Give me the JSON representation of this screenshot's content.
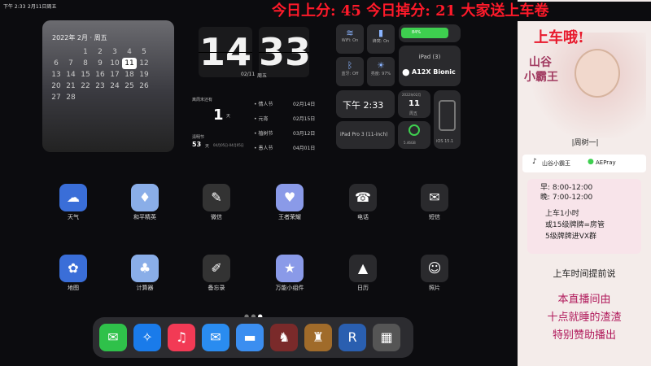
{
  "status_bar": {
    "time": "下午 2:33",
    "date": "2月11日周五",
    "battery": "84%"
  },
  "banner": {
    "text": "今日上分: 45 今日掉分: 21 大家送上车卷",
    "text2": "上车哦!"
  },
  "calendar_widget": {
    "header": "2022年 2月 · 周五",
    "today": "11",
    "rows": [
      [
        "",
        "",
        "1",
        "2",
        "3",
        "4",
        "5"
      ],
      [
        "6",
        "7",
        "8",
        "9",
        "10",
        "11",
        "12"
      ],
      [
        "13",
        "14",
        "15",
        "16",
        "17",
        "18",
        "19"
      ],
      [
        "20",
        "21",
        "22",
        "23",
        "24",
        "25",
        "26"
      ],
      [
        "27",
        "28",
        "",
        "",
        "",
        "",
        ""
      ]
    ]
  },
  "clock": {
    "hour": "14",
    "minute": "33",
    "date": "02/11",
    "weekday": "周五"
  },
  "countdown": {
    "title": "离周末还有",
    "days": "1",
    "unit": "天",
    "holiday": "清明节",
    "holiday_days": "53",
    "holiday_unit": "天",
    "holiday_date": "04月05日-04月05日",
    "events": [
      {
        "name": "情人节",
        "date": "02月14日"
      },
      {
        "name": "元宵",
        "date": "02月15日"
      },
      {
        "name": "植树节",
        "date": "03月12日"
      },
      {
        "name": "愚人节",
        "date": "04月01日"
      }
    ]
  },
  "toggles": [
    {
      "icon": "wifi-icon",
      "label": "WiFi: On"
    },
    {
      "icon": "cellular-icon",
      "label": "蜂窝: On"
    },
    {
      "icon": "bluetooth-icon",
      "label": "蓝牙: Off"
    },
    {
      "icon": "brightness-icon",
      "label": "亮度: 97%"
    }
  ],
  "battery_widget": {
    "value": "84%"
  },
  "device": {
    "model": "iPad (3)",
    "chip": "A12X Bionic",
    "name": "iPad Pro 3 (11-inch)",
    "ios": "iOS 15.1"
  },
  "time_widget": {
    "time": "下午 2:33",
    "date_label": "2022年02月",
    "day": "11",
    "weekday": "周五"
  },
  "storage": {
    "label": "5.46GB"
  },
  "apps_row1": [
    {
      "label": "天气",
      "icon": "weather-icon",
      "glyph": "☁"
    },
    {
      "label": "和平精英",
      "icon": "game-icon",
      "glyph": "♦"
    },
    {
      "label": "微信",
      "icon": "wechat-icon",
      "glyph": "✎"
    },
    {
      "label": "王者荣耀",
      "icon": "game2-icon",
      "glyph": "♥"
    },
    {
      "label": "电话",
      "icon": "phone-icon",
      "glyph": "☎"
    },
    {
      "label": "短信",
      "icon": "message-icon",
      "glyph": "✉"
    }
  ],
  "apps_row2": [
    {
      "label": "地图",
      "icon": "map-icon",
      "glyph": "✿"
    },
    {
      "label": "计算器",
      "icon": "calculator-icon",
      "glyph": "♣"
    },
    {
      "label": "备忘录",
      "icon": "notes-icon",
      "glyph": "✐"
    },
    {
      "label": "万能小组件",
      "icon": "widget-icon",
      "glyph": "★"
    },
    {
      "label": "日历",
      "icon": "calendar-icon",
      "glyph": "▲"
    },
    {
      "label": "照片",
      "icon": "photos-icon",
      "glyph": "☺"
    }
  ],
  "dock": [
    {
      "icon": "messages-icon",
      "glyph": "✉"
    },
    {
      "icon": "safari-icon",
      "glyph": "✧"
    },
    {
      "icon": "music-icon",
      "glyph": "♫"
    },
    {
      "icon": "mail-icon",
      "glyph": "✉"
    },
    {
      "icon": "files-icon",
      "glyph": "▬"
    },
    {
      "icon": "game-a-icon",
      "glyph": "♞"
    },
    {
      "icon": "game-b-icon",
      "glyph": "♜"
    },
    {
      "icon": "rr-icon",
      "glyph": "R"
    },
    {
      "icon": "folder-icon",
      "glyph": "▦"
    }
  ],
  "streamer": {
    "name_line1": "山谷",
    "name_line2": "小霸王",
    "tag": "|周树一|",
    "douyin": "山谷小霸王",
    "wechat": "AEPray",
    "schedule": [
      "早: 8:00-12:00",
      "晚: 7:00-12:00"
    ],
    "rules": [
      "上车1小时",
      "或15级牌牌=房管",
      "5级牌牌进VX群"
    ],
    "footer_title": "上车时间提前说",
    "sponsor": [
      "本直播间由",
      "十点就睡的渣渣",
      "特别赞助播出"
    ]
  },
  "colors": {
    "accent_red": "#e8192c",
    "battery_green": "#3ecf4f",
    "side_bg": "#f4ecea"
  }
}
